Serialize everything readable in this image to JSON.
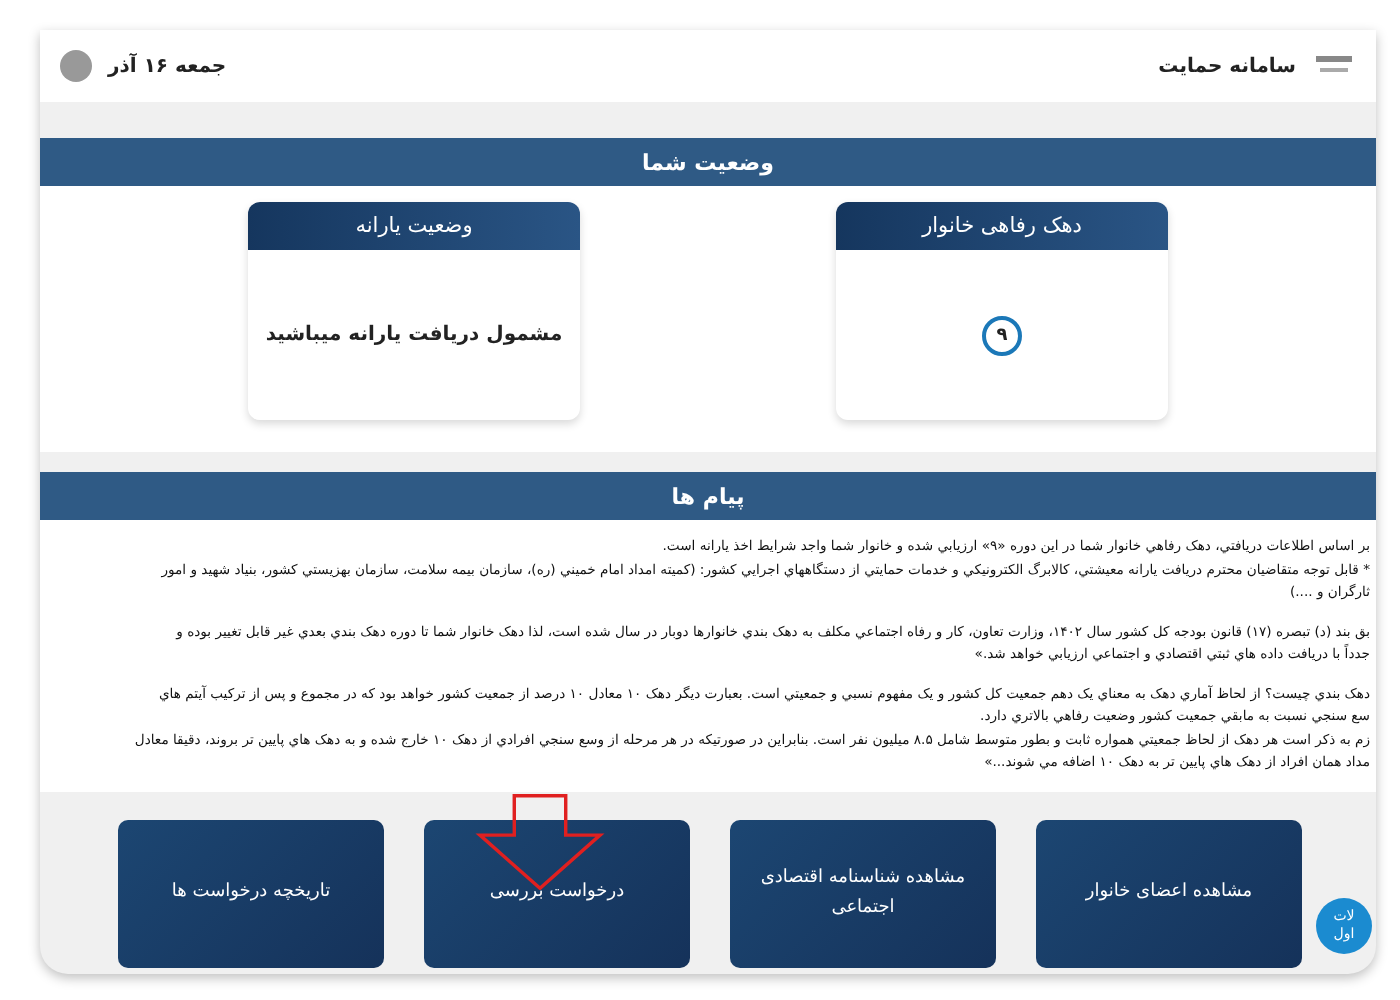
{
  "header": {
    "title": "سامانه حمایت",
    "date": "جمعه ۱۶ آذر"
  },
  "status_section": {
    "title": "وضعیت شما",
    "cards": [
      {
        "kind": "decile",
        "title": "دهک رفاهی خانوار",
        "value": "۹"
      },
      {
        "kind": "text",
        "title": "وضعیت یارانه",
        "value": "مشمول دریافت یارانه میباشید"
      }
    ]
  },
  "messages": {
    "title": "پیام ها",
    "paragraphs": [
      [
        "بر اساس اطلاعات دریافتي، دهک رفاهي خانوار شما در این دوره «۹» ارزیابي شده و خانوار شما واجد شرایط اخذ یارانه است.",
        "* قابل توجه متقاضیان محترم دریافت یارانه معیشتي، کالابرگ الکترونیکي و خدمات حمایتي از دستگاههاي اجرایي کشور: (کمیته امداد امام خمیني (ره)، سازمان بیمه سلامت، سازمان بهزیستي کشور، بنیاد شهید و امور",
        "ثارگران و ....)"
      ],
      [
        "بق بند (د) تبصره (۱۷) قانون بودجه کل کشور سال ۱۴۰۲، وزارت تعاون، کار و رفاه اجتماعي مکلف به دهک بندي خانوارها دوبار در سال شده است، لذا دهک خانوار شما تا دوره دهک بندي بعدي غیر قابل تغییر بوده و",
        "جدداً با دریافت داده هاي ثبتي اقتصادي و اجتماعي ارزیابي خواهد شد.»"
      ],
      [
        "دهک بندي چیست؟ از لحاظ آماري دهک به معناي یک دهم جمعیت کل کشور و یک مفهوم نسبي و جمعیتي است. بعبارت دیگر دهک ۱۰ معادل ۱۰ درصد از جمعیت کشور خواهد بود که در مجموع و پس از ترکیب آیتم هاي",
        "سع سنجي نسبت به مابقي جمعیت کشور وضعیت رفاهي بالاتري دارد.",
        "زم به ذکر است هر دهک از لحاظ جمعیتي همواره ثابت و بطور متوسط شامل ۸.۵ میلیون نفر است. بنابراین در صورتیکه در هر مرحله از وسع سنجي افرادي از دهک ۱۰ خارج شده و به دهک هاي پایین تر بروند، دقیقا معادل",
        "مداد همان افراد از دهک هاي پایین تر به دهک ۱۰ اضافه مي شوند...»"
      ]
    ]
  },
  "actions": [
    {
      "label": "مشاهده اعضای خانوار"
    },
    {
      "label": "مشاهده شناسنامه اقتصادی اجتماعی"
    },
    {
      "label": "درخواست بررسی"
    },
    {
      "label": "تاریخچه درخواست ها"
    }
  ],
  "help_button": {
    "lines": [
      "لات",
      "اول"
    ]
  }
}
